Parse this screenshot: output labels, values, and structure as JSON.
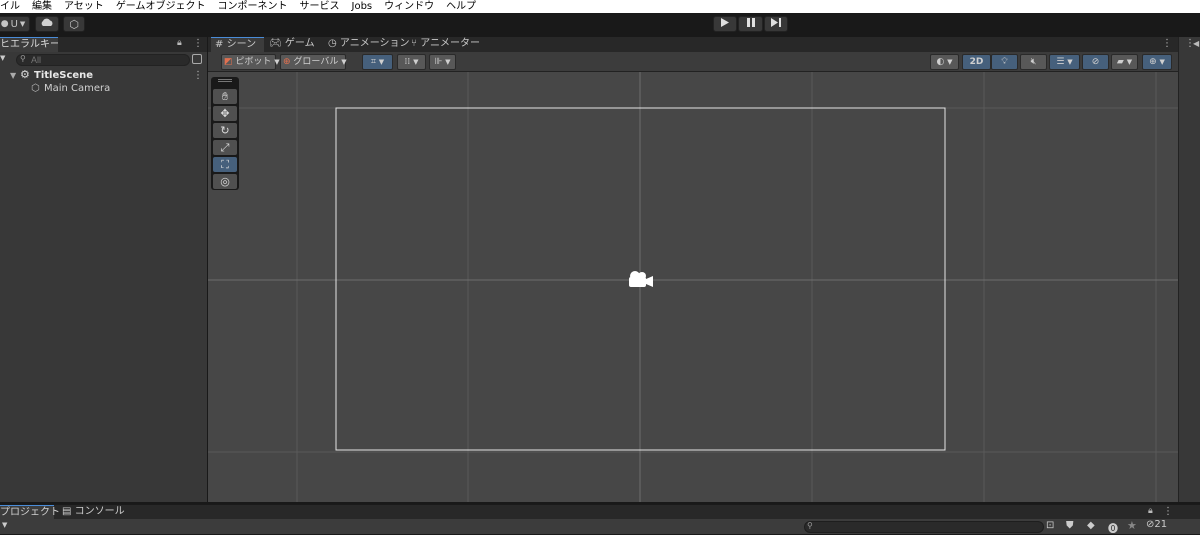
{
  "menu": [
    "イル",
    "編集",
    "アセット",
    "ゲームオブジェクト",
    "コンポーネント",
    "サービス",
    "Jobs",
    "ウィンドウ",
    "ヘルプ"
  ],
  "toolbar": {
    "account_label": "U"
  },
  "hierarchy": {
    "tab_label": "ヒエラルキー",
    "search_placeholder": "All",
    "scene_name": "TitleScene",
    "objects": [
      "Main Camera"
    ]
  },
  "scene_tabs": [
    {
      "label": "シーン",
      "icon": "grid-icon"
    },
    {
      "label": "ゲーム",
      "icon": "gamepad-icon"
    },
    {
      "label": "アニメーション",
      "icon": "clock-icon"
    },
    {
      "label": "アニメーター",
      "icon": "animator-icon"
    }
  ],
  "scene_toolbar": {
    "pivot_label": "ピボット",
    "global_label": "グローバル",
    "mode_2d_label": "2D"
  },
  "tools": [
    "hand-tool",
    "move-tool",
    "rotate-tool",
    "scale-tool",
    "rect-tool",
    "transform-tool"
  ],
  "bottom_tabs": [
    {
      "label": "プロジェクト",
      "icon": "folder-icon"
    },
    {
      "label": "コンソール",
      "icon": "console-icon"
    }
  ],
  "project": {
    "hidden_count": "21"
  },
  "colors": {
    "accent": "#46607c",
    "tab_highlight": "#4a8cd8",
    "viewport_bg": "#474747"
  }
}
